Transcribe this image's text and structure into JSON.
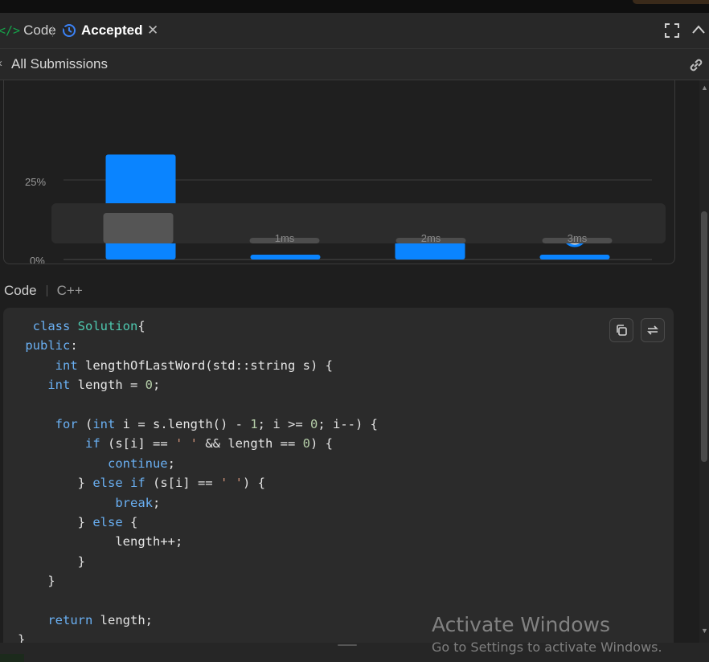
{
  "tabs": {
    "code_label": "Code",
    "accepted_label": "Accepted"
  },
  "subheader": {
    "title": "All Submissions"
  },
  "chart_data": {
    "type": "bar",
    "categories": [
      "",
      "1ms",
      "2ms",
      "3ms"
    ],
    "values": [
      33,
      1.5,
      5.5,
      1.5
    ],
    "ylabel": "",
    "ytick_labels": [
      "25%",
      "0%"
    ],
    "ylim": [
      0,
      33
    ],
    "highlight_category": "3ms",
    "bar_color": "#0a84ff",
    "navigator_categories": [
      "",
      "1ms",
      "2ms",
      "3ms"
    ],
    "navigator_color": "#4d4d4d"
  },
  "code_section": {
    "title": "Code",
    "language": "C++"
  },
  "code_lines": [
    {
      "indent": "  ",
      "parts": [
        [
          "kw",
          "class "
        ],
        [
          "ty",
          "Solution"
        ],
        [
          "fn",
          "{"
        ]
      ]
    },
    {
      "indent": " ",
      "parts": [
        [
          "kw",
          "public"
        ],
        [
          "fn",
          ":"
        ]
      ]
    },
    {
      "indent": "     ",
      "parts": [
        [
          "kw",
          "int "
        ],
        [
          "fn",
          "lengthOfLastWord(std::string s) {"
        ]
      ]
    },
    {
      "indent": "    ",
      "parts": [
        [
          "kw",
          "int "
        ],
        [
          "fn",
          "length = "
        ],
        [
          "num",
          "0"
        ],
        [
          "fn",
          ";"
        ]
      ]
    },
    {
      "indent": "",
      "parts": []
    },
    {
      "indent": "     ",
      "parts": [
        [
          "kw",
          "for "
        ],
        [
          "fn",
          "("
        ],
        [
          "kw",
          "int "
        ],
        [
          "fn",
          "i = s."
        ],
        [
          "fn",
          "length() - "
        ],
        [
          "num",
          "1"
        ],
        [
          "fn",
          "; i >= "
        ],
        [
          "num",
          "0"
        ],
        [
          "fn",
          "; i--) {"
        ]
      ]
    },
    {
      "indent": "         ",
      "parts": [
        [
          "kw",
          "if "
        ],
        [
          "fn",
          "(s[i] == "
        ],
        [
          "str",
          "' '"
        ],
        [
          "fn",
          " && length == "
        ],
        [
          "num",
          "0"
        ],
        [
          "fn",
          ") {"
        ]
      ]
    },
    {
      "indent": "            ",
      "parts": [
        [
          "kw",
          "continue"
        ],
        [
          "fn",
          ";"
        ]
      ]
    },
    {
      "indent": "        ",
      "parts": [
        [
          "fn",
          "} "
        ],
        [
          "kw",
          "else if "
        ],
        [
          "fn",
          "(s[i] == "
        ],
        [
          "str",
          "' '"
        ],
        [
          "fn",
          ") {"
        ]
      ]
    },
    {
      "indent": "             ",
      "parts": [
        [
          "kw",
          "break"
        ],
        [
          "fn",
          ";"
        ]
      ]
    },
    {
      "indent": "        ",
      "parts": [
        [
          "fn",
          "} "
        ],
        [
          "kw",
          "else "
        ],
        [
          "fn",
          "{"
        ]
      ]
    },
    {
      "indent": "             ",
      "parts": [
        [
          "fn",
          "length++;"
        ]
      ]
    },
    {
      "indent": "        ",
      "parts": [
        [
          "fn",
          "}"
        ]
      ]
    },
    {
      "indent": "    ",
      "parts": [
        [
          "fn",
          "}"
        ]
      ]
    },
    {
      "indent": "",
      "parts": []
    },
    {
      "indent": "    ",
      "parts": [
        [
          "kw",
          "return "
        ],
        [
          "fn",
          "length;"
        ]
      ]
    },
    {
      "indent": "",
      "parts": [
        [
          "fn",
          "}"
        ]
      ]
    }
  ],
  "watermark": {
    "title": "Activate Windows",
    "subtitle": "Go to Settings to activate Windows."
  }
}
